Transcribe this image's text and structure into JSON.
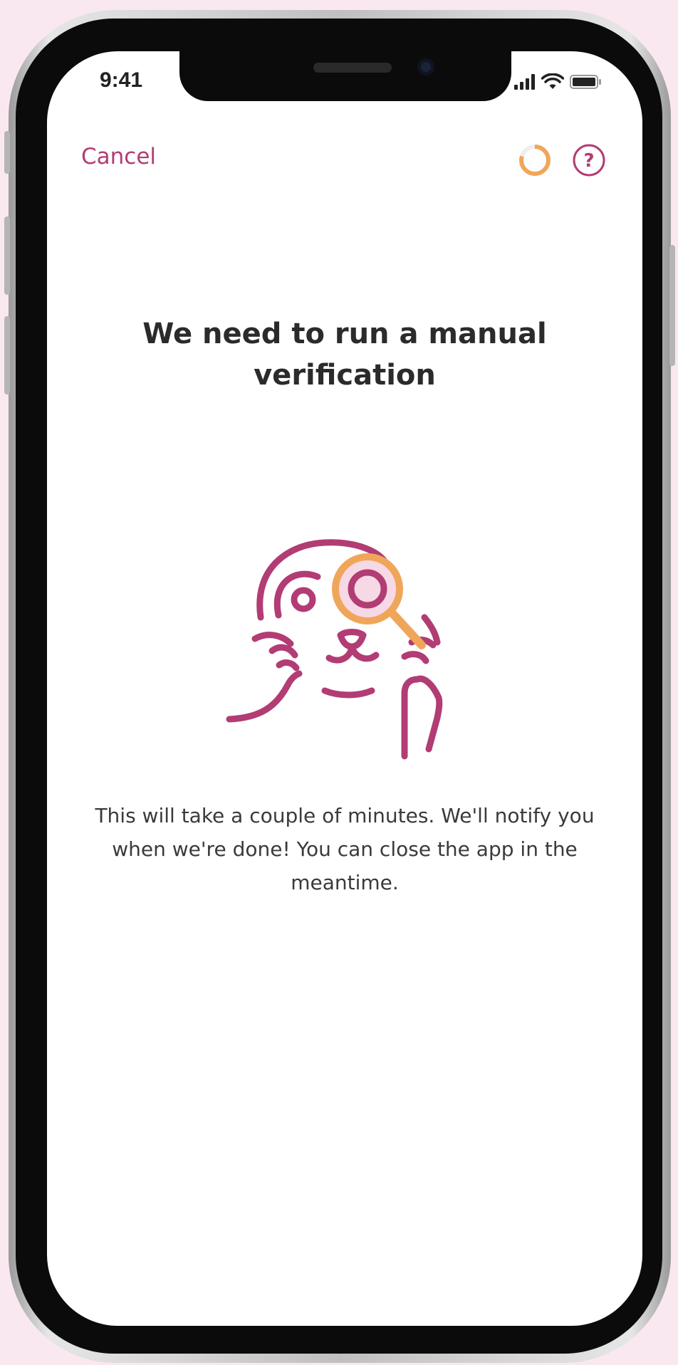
{
  "status_bar": {
    "time": "9:41",
    "icons": [
      "signal-icon",
      "wifi-icon",
      "battery-icon"
    ]
  },
  "nav": {
    "cancel_label": "Cancel",
    "progress_icon": "progress-ring-icon",
    "help_icon": "help-icon"
  },
  "content": {
    "title": "We need to run a manual verification",
    "illustration": "seal-with-magnifier-illustration",
    "message": "This will take a couple of minutes. We'll notify you when we're done! You can close the app in the meantime."
  },
  "colors": {
    "accent": "#b23c74",
    "highlight": "#f0a65a",
    "background": "#fae8f0",
    "lens_fill": "#f7d9e6"
  }
}
